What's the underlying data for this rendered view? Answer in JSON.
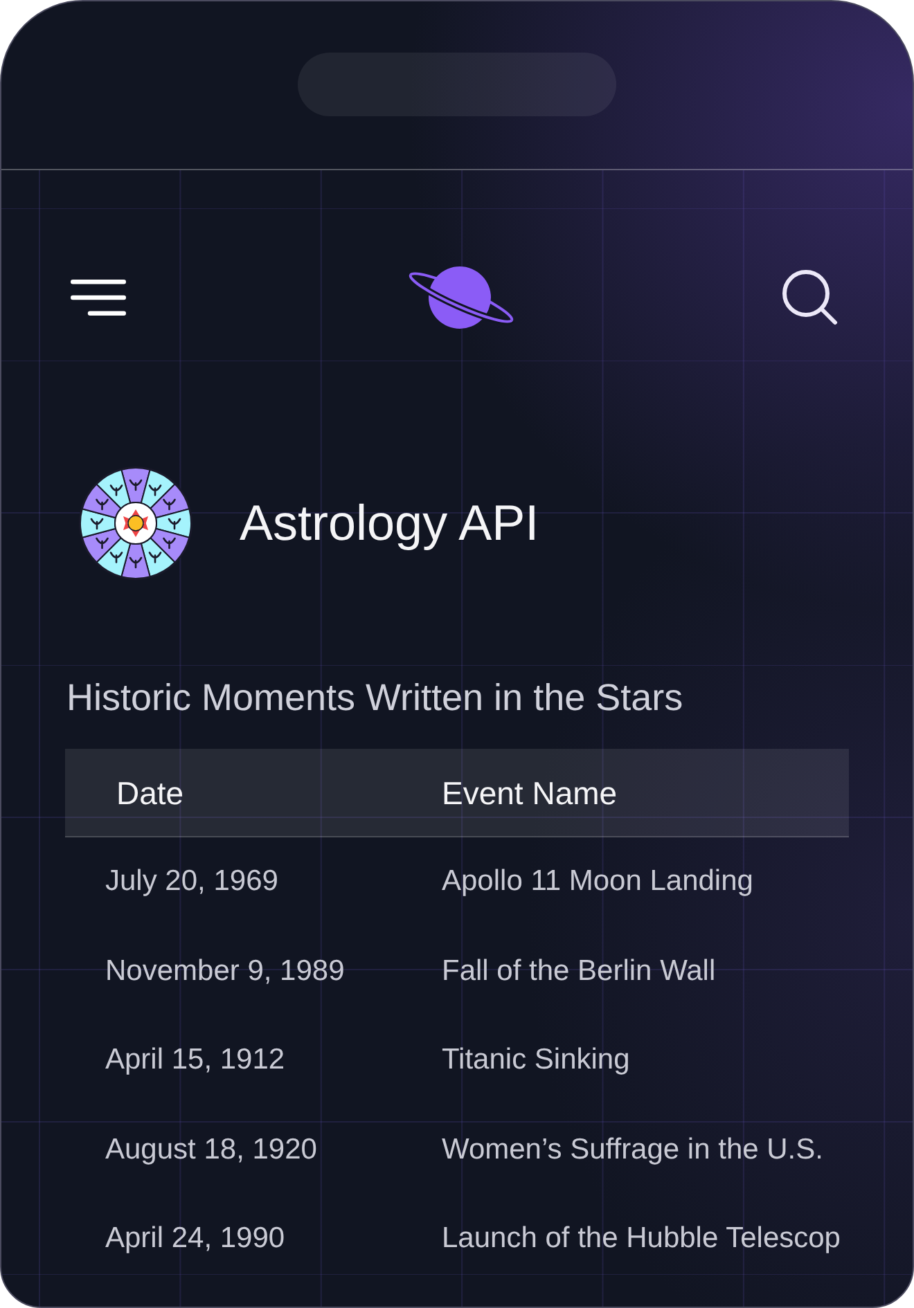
{
  "app": {
    "title": "Astrology API"
  },
  "section": {
    "title": "Historic Moments Written in the Stars"
  },
  "table": {
    "columns": [
      "Date",
      "Event Name"
    ],
    "rows": [
      {
        "date": "July 20, 1969",
        "event": "Apollo 11 Moon Landing"
      },
      {
        "date": "November 9, 1989",
        "event": "Fall of the Berlin Wall"
      },
      {
        "date": "April 15, 1912",
        "event": "Titanic Sinking"
      },
      {
        "date": "August 18, 1920",
        "event": "Women’s Suffrage in the U.S."
      },
      {
        "date": "April 24, 1990",
        "event": "Launch of the Hubble Telescop"
      }
    ]
  }
}
